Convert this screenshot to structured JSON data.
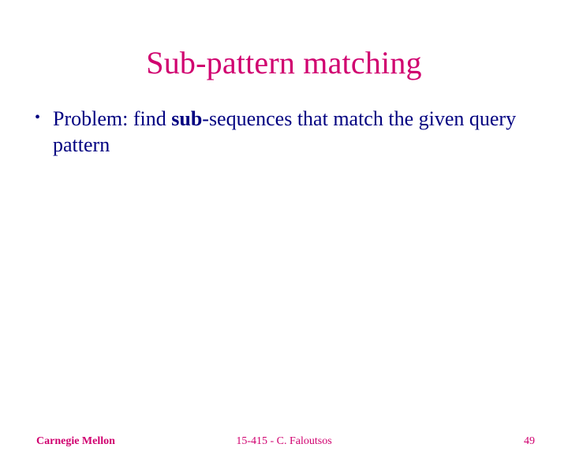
{
  "title": "Sub-pattern matching",
  "bullet": {
    "prefix": "Problem: find ",
    "bold": "sub",
    "suffix": "-sequences that match the given query pattern"
  },
  "footer": {
    "left": "Carnegie Mellon",
    "center": "15-415 - C. Faloutsos",
    "right": "49"
  }
}
